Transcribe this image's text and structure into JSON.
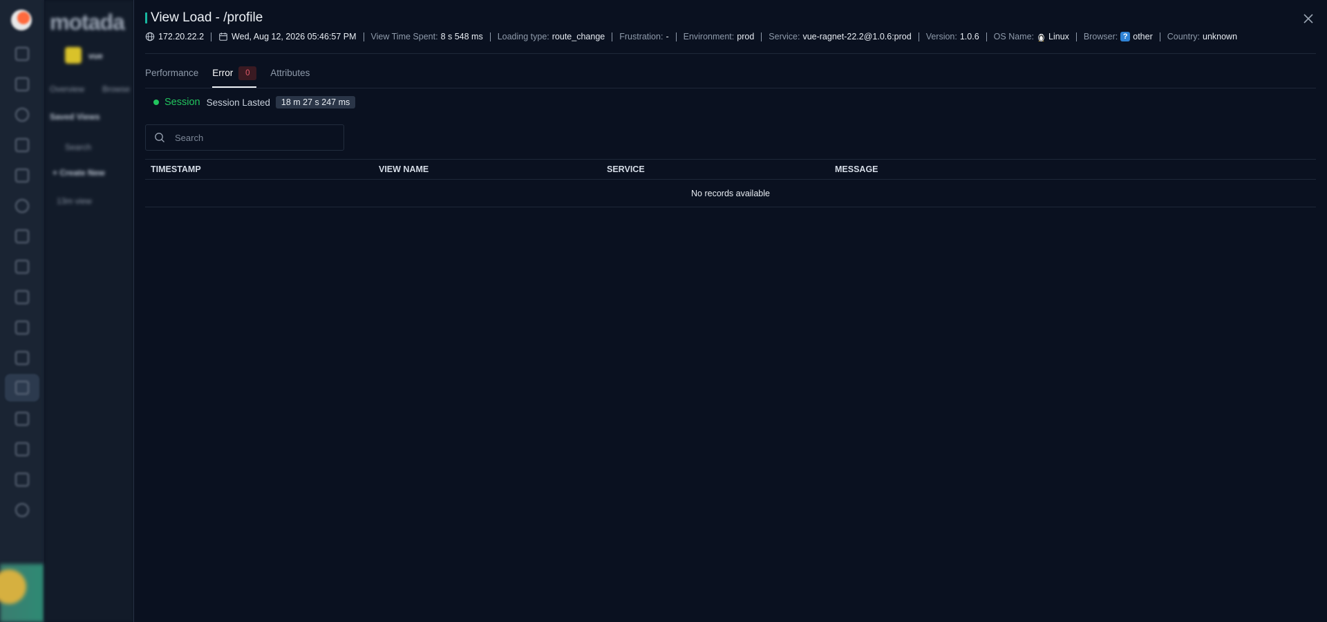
{
  "background": {
    "brand": "motada",
    "tabs": [
      "Overview",
      "Browse"
    ],
    "saved_views": "Saved Views",
    "search": "Search",
    "create_new": "+ Create New",
    "item": "13m view",
    "app_chip": "vue"
  },
  "view": {
    "title": "View Load - /profile",
    "close_icon": "close-icon"
  },
  "meta": {
    "ip": "172.20.22.2",
    "date": "Wed, Aug 12, 2026 05:46:57 PM",
    "time_spent_label": "View Time Spent:",
    "time_spent_value": "8 s 548 ms",
    "loading_type_label": "Loading type:",
    "loading_type_value": "route_change",
    "frustration_label": "Frustration:",
    "frustration_value": "-",
    "environment_label": "Environment:",
    "environment_value": "prod",
    "service_label": "Service:",
    "service_value": "vue-ragnet-22.2@1.0.6:prod",
    "version_label": "Version:",
    "version_value": "1.0.6",
    "os_label": "OS Name:",
    "os_value": "Linux",
    "browser_label": "Browser:",
    "browser_icon_text": "?",
    "browser_value": "other",
    "country_label": "Country:",
    "country_value": "unknown"
  },
  "tabs": [
    {
      "label": "Performance",
      "active": false
    },
    {
      "label": "Error",
      "active": true,
      "badge": "0"
    },
    {
      "label": "Attributes",
      "active": false
    }
  ],
  "session": {
    "label": "Session",
    "lasted_label": "Session Lasted",
    "duration": "18 m 27 s 247 ms"
  },
  "search": {
    "placeholder": "Search"
  },
  "table": {
    "columns": [
      "TIMESTAMP",
      "VIEW NAME",
      "SERVICE",
      "MESSAGE"
    ],
    "empty_text": "No records available"
  },
  "colors": {
    "accent": "#18b6a0",
    "session_green": "#22c55e",
    "error_badge": "#e25a6a",
    "background": "#0a1120"
  }
}
